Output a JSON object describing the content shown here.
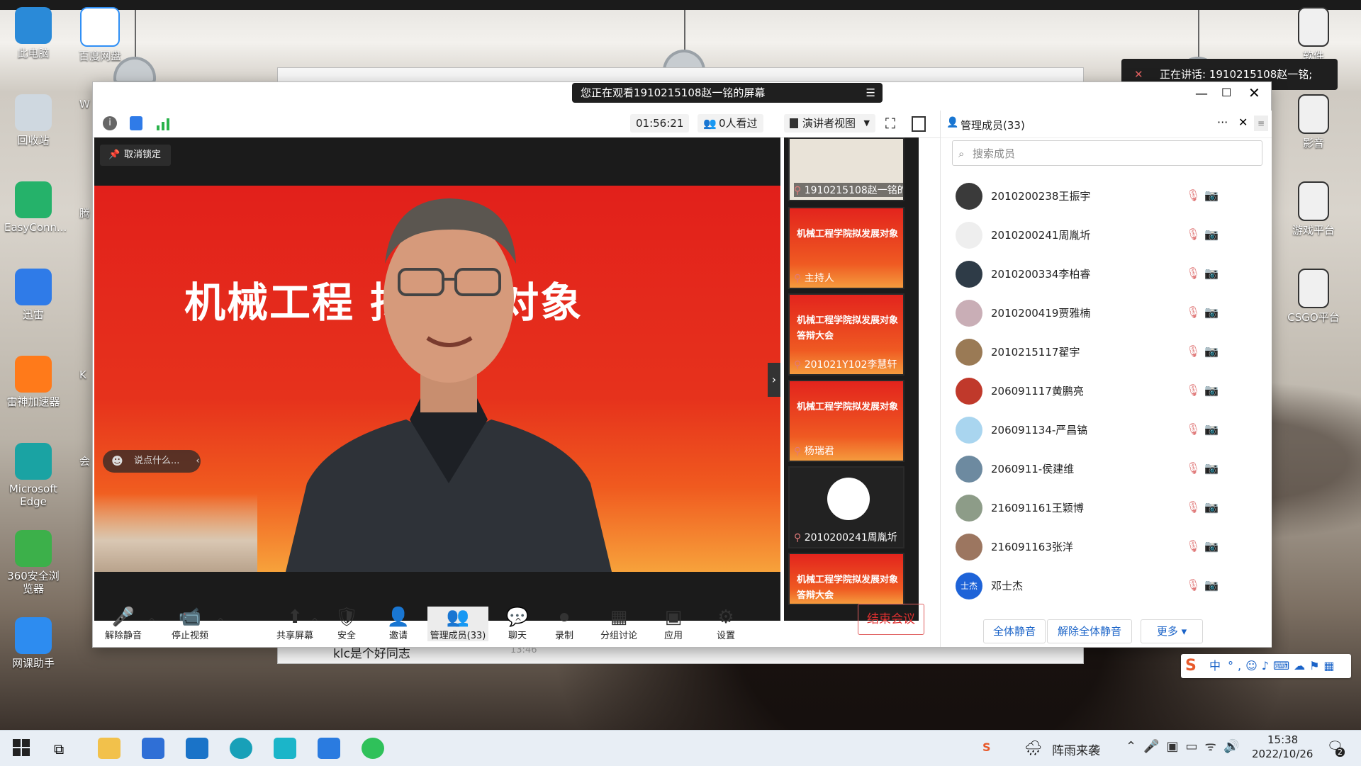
{
  "desktop": {
    "left_icons": [
      {
        "label": "此电脑",
        "name": "this-pc-icon",
        "color": "#2a8ad8"
      },
      {
        "label": "回收站",
        "name": "recycle-bin-icon",
        "color": "#cfd8e0"
      },
      {
        "label": "EasyConn...",
        "name": "easyconnect-icon",
        "color": "#25b26a"
      },
      {
        "label": "迅雷",
        "name": "thunder-icon",
        "color": "#2f7be8"
      },
      {
        "label": "雷神加速器",
        "name": "leishen-icon",
        "color": "#ff7a1a"
      },
      {
        "label": "Microsoft Edge",
        "name": "edge-icon",
        "color": "#1aa3a3"
      },
      {
        "label": "360安全浏览器",
        "name": "360-browser-icon",
        "color": "#3cb04a"
      },
      {
        "label": "网课助手",
        "name": "class-helper-icon",
        "color": "#2d8cf0"
      }
    ],
    "second_col_icons": [
      {
        "label": "百度网盘",
        "name": "baidu-pan-icon",
        "color": "#2f8ff5"
      }
    ],
    "partial_icons": [
      "W",
      "腾",
      "K",
      "会"
    ],
    "right_icons": [
      {
        "label": "软件",
        "name": "software-icon"
      },
      {
        "label": "影音",
        "name": "media-icon"
      },
      {
        "label": "游戏平台",
        "name": "game-platform-icon"
      },
      {
        "label": "CSGO平台",
        "name": "csgo-icon"
      }
    ]
  },
  "meeting": {
    "banner": "您正在观看1910215108赵一铭的屏幕",
    "timer": "01:56:21",
    "viewers": "0人看过",
    "view_mode": "演讲者视图",
    "unpin": "取消锁定",
    "chat_placeholder": "说点什么...",
    "stage_title": "机械工程  拟发展对象",
    "thumbs": [
      {
        "label": "1910215108赵一铭的...",
        "kind": "screen"
      },
      {
        "label": "主持人",
        "kind": "red",
        "text": "机械工程学院拟发展对象"
      },
      {
        "label": "201021Y102李慧轩",
        "kind": "red",
        "text": "机械工程学院拟发展对象\n答辩大会"
      },
      {
        "label": "杨瑞君",
        "kind": "red",
        "text": "机械工程学院拟发展对象"
      },
      {
        "label": "2010200241周胤圻",
        "kind": "avatar"
      },
      {
        "label": "",
        "kind": "red",
        "text": "机械工程学院拟发展对象\n答辩大会"
      }
    ],
    "toolbar": [
      {
        "label": "解除静音",
        "glyph": "🎤",
        "name": "unmute-button"
      },
      {
        "label": "停止视频",
        "glyph": "📹",
        "name": "stop-video-button"
      },
      {
        "label": "共享屏幕",
        "glyph": "⬆",
        "name": "share-screen-button"
      },
      {
        "label": "安全",
        "glyph": "🛡",
        "name": "security-button"
      },
      {
        "label": "邀请",
        "glyph": "👤",
        "name": "invite-button"
      },
      {
        "label": "管理成员(33)",
        "glyph": "👥",
        "name": "manage-members-button"
      },
      {
        "label": "聊天",
        "glyph": "💬",
        "name": "chat-button"
      },
      {
        "label": "录制",
        "glyph": "⏺",
        "name": "record-button"
      },
      {
        "label": "分组讨论",
        "glyph": "▦",
        "name": "breakout-button"
      },
      {
        "label": "应用",
        "glyph": "▣",
        "name": "apps-button"
      },
      {
        "label": "设置",
        "glyph": "⚙",
        "name": "settings-button"
      }
    ],
    "end_meeting": "结束会议",
    "speaking": "正在讲话: 1910215108赵一铭;"
  },
  "panel": {
    "title": "管理成员(33)",
    "search_placeholder": "搜索成员",
    "members": [
      {
        "name": "2010200238王振宇",
        "color": "#3a3a3a"
      },
      {
        "name": "2010200241周胤圻",
        "color": "#eeeeee"
      },
      {
        "name": "2010200334李柏睿",
        "color": "#2e3b47"
      },
      {
        "name": "2010200419贾雅楠",
        "color": "#c9aeb6"
      },
      {
        "name": "2010215117翟宇",
        "color": "#9a7a55"
      },
      {
        "name": "206091117黄鹏亮",
        "color": "#c0392b"
      },
      {
        "name": "206091134-严昌镐",
        "color": "#a9d5ef"
      },
      {
        "name": "2060911-侯建维",
        "color": "#6d8aa0"
      },
      {
        "name": "216091161王颖博",
        "color": "#8d9c88"
      },
      {
        "name": "216091163张洋",
        "color": "#9c7660"
      },
      {
        "name": "邓士杰",
        "color": "#1e63d8",
        "badge": "士杰"
      }
    ],
    "mute_all": "全体静音",
    "unmute_all": "解除全体静音",
    "more": "更多"
  },
  "chat_peek": {
    "text": "klc是个好同志",
    "time": "13:46"
  },
  "taskbar": {
    "weather": "阵雨来袭",
    "time": "15:38",
    "date": "2022/10/26",
    "ime": "中",
    "notif_count": "2"
  }
}
